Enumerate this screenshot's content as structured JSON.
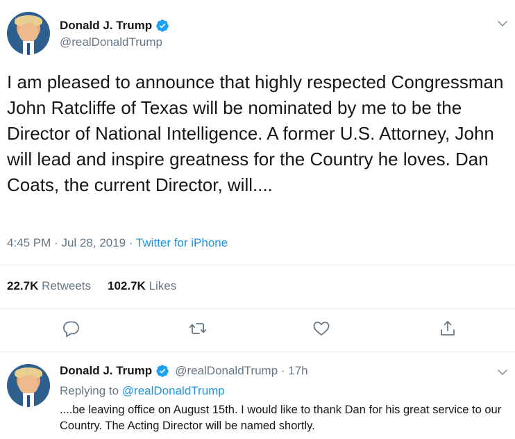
{
  "main_tweet": {
    "author_name": "Donald J. Trump",
    "handle": "@realDonaldTrump",
    "text": "I am pleased to announce that highly respected Congressman John Ratcliffe of Texas will be nominated by me to be the Director of National Intelligence. A former U.S. Attorney, John will lead and inspire greatness for the Country he loves. Dan Coats, the current Director, will....",
    "time": "4:45 PM",
    "date": "Jul 28, 2019",
    "separator": "·",
    "source": "Twitter for iPhone",
    "retweets_count": "22.7K",
    "retweets_label": "Retweets",
    "likes_count": "102.7K",
    "likes_label": "Likes"
  },
  "actions": {
    "reply_icon": "reply-icon",
    "retweet_icon": "retweet-icon",
    "like_icon": "heart-icon",
    "share_icon": "share-icon"
  },
  "reply_tweet": {
    "author_name": "Donald J. Trump",
    "handle_time": "@realDonaldTrump · 17h",
    "replying_prefix": "Replying to",
    "replying_to": "@realDonaldTrump",
    "text": "....be leaving office on August 15th. I would like to thank Dan for his great service to our Country. The Acting Director will be named shortly."
  },
  "colors": {
    "brand_blue": "#1da1f2",
    "link_blue": "#1b95e0",
    "secondary_text": "#657786",
    "primary_text": "#14171a"
  }
}
